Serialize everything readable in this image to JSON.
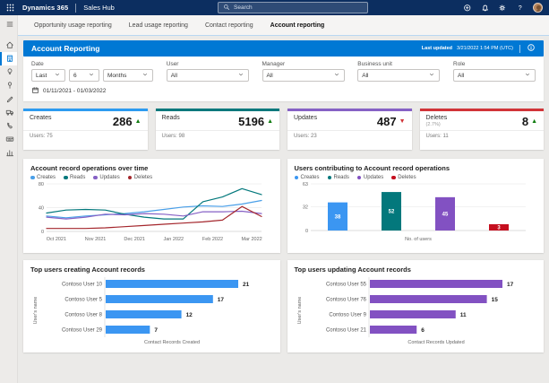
{
  "colors": {
    "accent": "#0078d4",
    "topbar_bg": "#0c2e60",
    "up_green": "#107c10",
    "down_red": "#d13438"
  },
  "topbar": {
    "brand": "Dynamics 365",
    "app": "Sales Hub",
    "search_placeholder": "Search",
    "icons": [
      "plus-circle-icon",
      "bell-icon",
      "gear-icon",
      "help-icon",
      "avatar"
    ]
  },
  "tabs": [
    {
      "label": "Opportunity usage reporting",
      "active": false
    },
    {
      "label": "Lead usage reporting",
      "active": false
    },
    {
      "label": "Contact reporting",
      "active": false
    },
    {
      "label": "Account reporting",
      "active": true
    }
  ],
  "sidebar": {
    "items": [
      "menu-icon",
      "home-icon",
      "building-icon",
      "lightbulb-icon",
      "pin-icon",
      "pencil-icon",
      "truck-icon",
      "phone-icon",
      "keyboard-icon",
      "chart-icon"
    ],
    "selected_index": 2
  },
  "header": {
    "title": "Account Reporting",
    "last_updated_label": "Last updated",
    "last_updated_value": "3/21/2022 1:54 PM (UTC)"
  },
  "filters": {
    "groups": [
      {
        "label": "Date",
        "selects": [
          "Last",
          "6",
          "Months"
        ]
      },
      {
        "label": "User",
        "selects": [
          "All"
        ]
      },
      {
        "label": "Manager",
        "selects": [
          "All"
        ]
      },
      {
        "label": "Business unit",
        "selects": [
          "All"
        ]
      },
      {
        "label": "Role",
        "selects": [
          "All"
        ]
      }
    ],
    "date_range": "01/11/2021 - 01/03/2022"
  },
  "kpis": [
    {
      "title": "Creates",
      "value": "286",
      "trend": "up",
      "users": "Users: 75",
      "color": "#2d9bf0"
    },
    {
      "title": "Reads",
      "value": "5196",
      "trend": "up",
      "users": "Users: 98",
      "color": "#03787c"
    },
    {
      "title": "Updates",
      "value": "487",
      "trend": "down",
      "users": "Users: 23",
      "color": "#8661c5"
    },
    {
      "title": "Deletes",
      "subtitle": "(2.7%)",
      "value": "8",
      "trend": "up",
      "users": "Users: 11",
      "color": "#d13438"
    }
  ],
  "chart_data": [
    {
      "id": "operations_over_time",
      "type": "line",
      "title": "Account record operations over time",
      "x_labels": [
        "Oct 2021",
        "Nov 2021",
        "Dec 2021",
        "Jan 2022",
        "Feb 2022",
        "Mar 2022"
      ],
      "ylim": [
        0,
        80
      ],
      "yticks": [
        0,
        40,
        80
      ],
      "legend_position": "top",
      "grid": true,
      "series": [
        {
          "name": "Creates",
          "color": "#4a9fe8",
          "values": [
            26,
            23,
            26,
            28,
            30,
            33,
            37,
            41,
            43,
            42,
            46,
            52
          ]
        },
        {
          "name": "Reads",
          "color": "#03787c",
          "values": [
            31,
            36,
            37,
            36,
            29,
            24,
            21,
            21,
            50,
            58,
            72,
            62
          ]
        },
        {
          "name": "Updates",
          "color": "#8661c5",
          "values": [
            24,
            21,
            24,
            29,
            28,
            30,
            29,
            26,
            33,
            33,
            34,
            30
          ]
        },
        {
          "name": "Deletes",
          "color": "#a4262c",
          "values": [
            5,
            5,
            5,
            6,
            8,
            10,
            12,
            14,
            16,
            19,
            42,
            25
          ]
        }
      ]
    },
    {
      "id": "users_contributing",
      "type": "bar",
      "title": "Users contributing to Account record operations",
      "categories": [
        "Creates",
        "Reads",
        "Updates",
        "Deletes"
      ],
      "values": [
        38,
        52,
        45,
        3
      ],
      "colors": [
        "#3b96f2",
        "#03787c",
        "#8251c2",
        "#c50f1f"
      ],
      "ylim": [
        0,
        63
      ],
      "yticks": [
        0,
        32,
        63
      ],
      "xlabel": "No. of users",
      "legend_position": "top",
      "grid": true
    },
    {
      "id": "top_users_creating",
      "type": "hbar",
      "title": "Top users creating Account records",
      "categories": [
        "Contoso User 10",
        "Contoso User 5",
        "Contoso User 8",
        "Contoso User 29"
      ],
      "values": [
        21,
        17,
        12,
        7
      ],
      "color": "#3b96f2",
      "xlabel": "Contact Records Created",
      "ylabel": "User's name"
    },
    {
      "id": "top_users_updating",
      "type": "hbar",
      "title": "Top users updating Account records",
      "categories": [
        "Contoso User 55",
        "Contoso User 76",
        "Contoso User 9",
        "Contoso User 21"
      ],
      "values": [
        17,
        15,
        11,
        6
      ],
      "color": "#8251c2",
      "xlabel": "Contact Records Updated",
      "ylabel": "User's name"
    }
  ]
}
